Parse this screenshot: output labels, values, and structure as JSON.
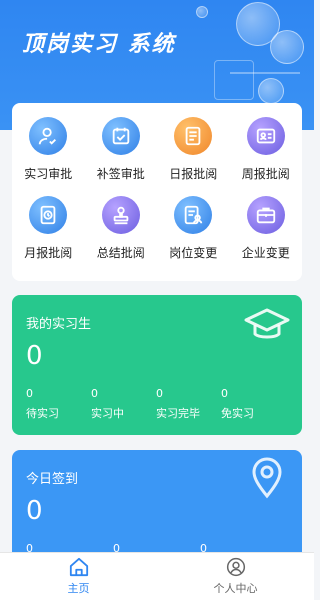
{
  "header": {
    "title": "顶岗实习 系统"
  },
  "menu": [
    {
      "label": "实习审批",
      "icon": "person-check-icon",
      "color": "blue"
    },
    {
      "label": "补签审批",
      "icon": "calendar-check-icon",
      "color": "blue"
    },
    {
      "label": "日报批阅",
      "icon": "daily-report-icon",
      "color": "orange"
    },
    {
      "label": "周报批阅",
      "icon": "id-card-icon",
      "color": "purple"
    },
    {
      "label": "月报批阅",
      "icon": "clock-doc-icon",
      "color": "blue"
    },
    {
      "label": "总结批阅",
      "icon": "stamp-icon",
      "color": "purple"
    },
    {
      "label": "岗位变更",
      "icon": "document-person-icon",
      "color": "blue"
    },
    {
      "label": "企业变更",
      "icon": "briefcase-icon",
      "color": "purple"
    }
  ],
  "my_interns": {
    "title": "我的实习生",
    "total": "0",
    "stats": [
      {
        "value": "0",
        "label": "待实习"
      },
      {
        "value": "0",
        "label": "实习中"
      },
      {
        "value": "0",
        "label": "实习完毕"
      },
      {
        "value": "0",
        "label": "免实习"
      }
    ]
  },
  "today_checkin": {
    "title": "今日签到",
    "total": "0",
    "stats": [
      {
        "value": "0"
      },
      {
        "value": "0"
      },
      {
        "value": "0"
      }
    ]
  },
  "nav": {
    "home_label": "主页",
    "profile_label": "个人中心"
  },
  "colors": {
    "primary": "#2f86f1",
    "green_card": "#27c88d",
    "blue_card": "#3b97f5"
  }
}
